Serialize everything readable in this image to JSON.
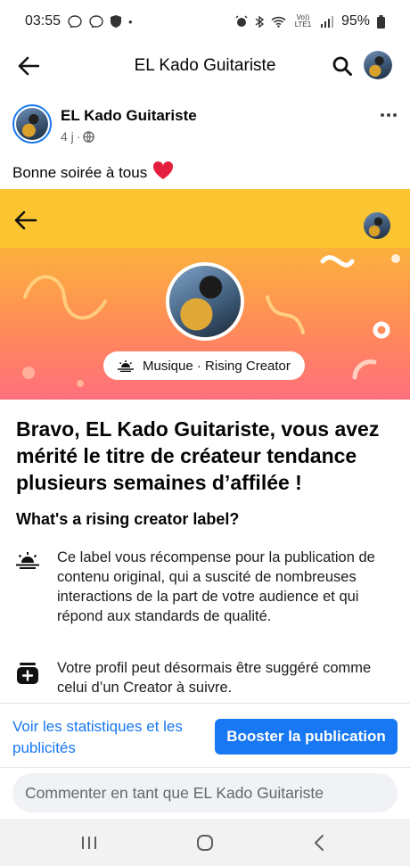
{
  "status_bar": {
    "time": "03:55",
    "left_icons": [
      "messenger-icon",
      "messenger-icon",
      "shield-icon",
      "dot-icon"
    ],
    "right_icons": [
      "alarm-icon",
      "bluetooth-icon",
      "wifi-icon",
      "volte-icon",
      "signal-icon",
      "battery-icon"
    ],
    "volte_label": "Vo)) LTE1",
    "battery": "95%"
  },
  "header": {
    "title": "EL Kado Guitariste"
  },
  "post": {
    "author": "EL Kado Guitariste",
    "time": "4 j",
    "separator": "·",
    "audience_icon": "globe-icon",
    "text": "Bonne soirée à tous",
    "emoji": "❤️"
  },
  "shared_image": {
    "badge": "Musique · Rising Creator",
    "headline": "Bravo, EL Kado Guitariste, vous avez mérité le titre de créateur tendance plusieurs semaines d’affilée !",
    "subheading": "What's a rising creator label?",
    "items": [
      {
        "icon": "sunrise-icon",
        "text": "Ce label vous récompense pour la publication de contenu original, qui a suscité de nombreuses interactions de la part de votre audience et qui répond aux standards de qualité."
      },
      {
        "icon": "add-profile-icon",
        "text": "Votre profil peut désormais être suggéré comme celui d’un Creator à suivre."
      }
    ],
    "colors": {
      "top_bar": "#fbc531",
      "gradient_start": "#fbb13c",
      "gradient_end": "#ff6f7d"
    }
  },
  "actions": {
    "stats_link": "Voir les statistiques et les publicités",
    "boost_button": "Booster la publication"
  },
  "comment": {
    "placeholder": "Commenter en tant que EL Kado Guitariste"
  },
  "nav": {
    "buttons": [
      "recents-icon",
      "home-icon",
      "back-icon"
    ]
  },
  "colors": {
    "accent": "#1877f2",
    "secondary_text": "#65676b",
    "input_bg": "#f0f2f5"
  }
}
